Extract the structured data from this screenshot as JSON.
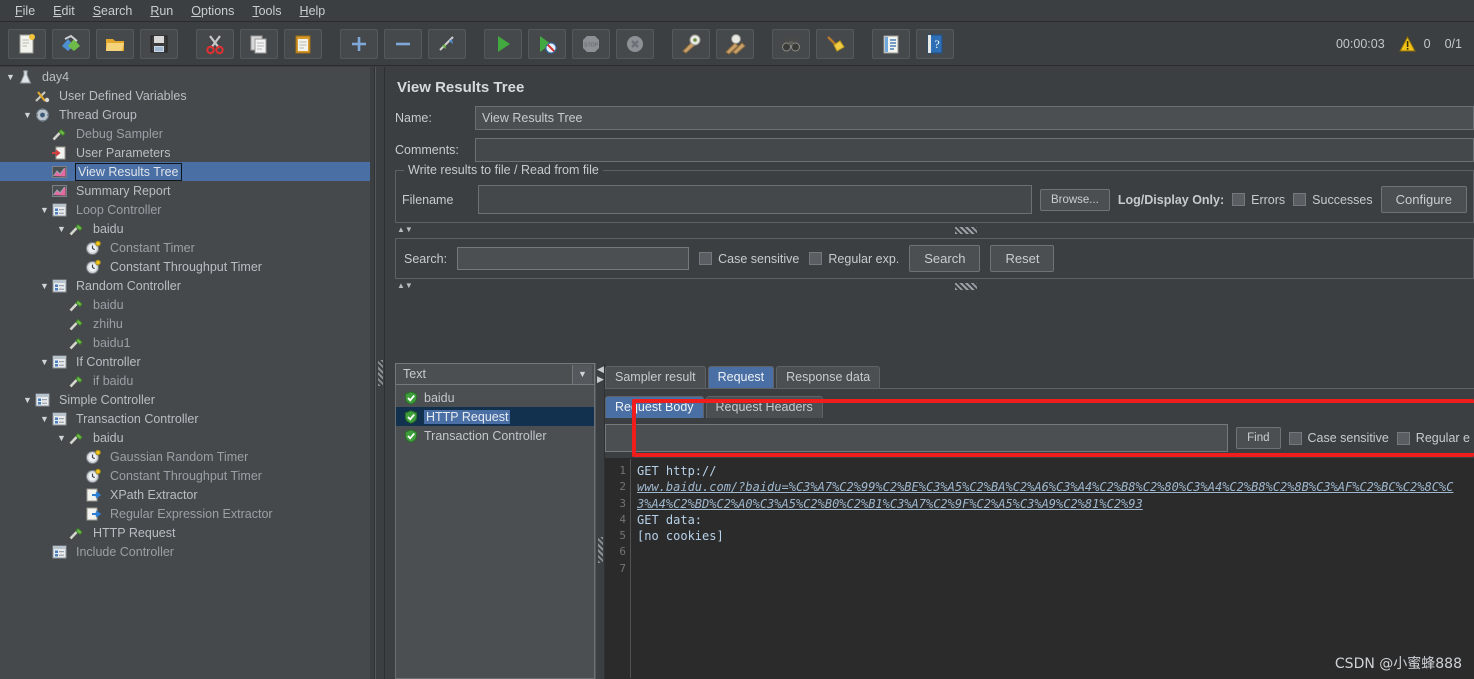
{
  "window": {
    "title": "Apache JMeter"
  },
  "menubar": {
    "items": [
      {
        "label": "File",
        "mnemonic": "F"
      },
      {
        "label": "Edit",
        "mnemonic": "E"
      },
      {
        "label": "Search",
        "mnemonic": "S"
      },
      {
        "label": "Run",
        "mnemonic": "R"
      },
      {
        "label": "Options",
        "mnemonic": "O"
      },
      {
        "label": "Tools",
        "mnemonic": "T"
      },
      {
        "label": "Help",
        "mnemonic": "H"
      }
    ]
  },
  "toolbar": {
    "buttons": [
      {
        "icon": "new-document-icon",
        "group": 1
      },
      {
        "icon": "templates-icon",
        "group": 1
      },
      {
        "icon": "open-folder-icon",
        "group": 1
      },
      {
        "icon": "save-floppy-icon",
        "group": 1
      },
      {
        "icon": "cut-scissors-icon",
        "group": 2
      },
      {
        "icon": "copy-icon",
        "group": 2
      },
      {
        "icon": "paste-clipboard-icon",
        "group": 2
      },
      {
        "icon": "expand-plus-icon",
        "group": 3
      },
      {
        "icon": "collapse-minus-icon",
        "group": 3
      },
      {
        "icon": "toggle-element-icon",
        "group": 3
      },
      {
        "icon": "start-play-icon",
        "group": 4
      },
      {
        "icon": "start-no-timers-icon",
        "group": 4
      },
      {
        "icon": "stop-icon",
        "group": 4
      },
      {
        "icon": "shutdown-icon",
        "group": 4
      },
      {
        "icon": "clear-icon",
        "group": 5
      },
      {
        "icon": "clear-all-icon",
        "group": 5
      },
      {
        "icon": "search-binoculars-icon",
        "group": 6
      },
      {
        "icon": "reset-search-broom-icon",
        "group": 6
      },
      {
        "icon": "function-helper-icon",
        "group": 7
      },
      {
        "icon": "help-question-icon",
        "group": 7
      }
    ],
    "elapsed_time": "00:00:03",
    "warning_count": "0",
    "thread_count": "0/1"
  },
  "tree": {
    "nodes": [
      {
        "label": "day4",
        "icon": "test-plan-icon",
        "indent": 0,
        "twisty": "down",
        "dim": false,
        "selected": false
      },
      {
        "label": "User Defined Variables",
        "icon": "config-element-icon",
        "indent": 1,
        "twisty": "",
        "dim": false,
        "selected": false
      },
      {
        "label": "Thread Group",
        "icon": "thread-group-icon",
        "indent": 1,
        "twisty": "down",
        "dim": false,
        "selected": false
      },
      {
        "label": "Debug Sampler",
        "icon": "sampler-icon",
        "indent": 2,
        "twisty": "",
        "dim": true,
        "selected": false
      },
      {
        "label": "User Parameters",
        "icon": "pre-processor-icon",
        "indent": 2,
        "twisty": "",
        "dim": false,
        "selected": false
      },
      {
        "label": "View Results Tree",
        "icon": "listener-icon",
        "indent": 2,
        "twisty": "",
        "dim": false,
        "selected": true
      },
      {
        "label": "Summary Report",
        "icon": "listener-icon",
        "indent": 2,
        "twisty": "",
        "dim": false,
        "selected": false
      },
      {
        "label": "Loop Controller",
        "icon": "controller-icon",
        "indent": 2,
        "twisty": "down",
        "dim": true,
        "selected": false
      },
      {
        "label": "baidu",
        "icon": "sampler-icon",
        "indent": 3,
        "twisty": "down",
        "dim": false,
        "selected": false
      },
      {
        "label": "Constant Timer",
        "icon": "timer-icon",
        "indent": 4,
        "twisty": "",
        "dim": true,
        "selected": false
      },
      {
        "label": "Constant Throughput Timer",
        "icon": "timer-icon",
        "indent": 4,
        "twisty": "",
        "dim": false,
        "selected": false
      },
      {
        "label": "Random Controller",
        "icon": "controller-icon",
        "indent": 2,
        "twisty": "down",
        "dim": false,
        "selected": false
      },
      {
        "label": "baidu",
        "icon": "sampler-icon",
        "indent": 3,
        "twisty": "",
        "dim": true,
        "selected": false
      },
      {
        "label": "zhihu",
        "icon": "sampler-icon",
        "indent": 3,
        "twisty": "",
        "dim": true,
        "selected": false
      },
      {
        "label": "baidu1",
        "icon": "sampler-icon",
        "indent": 3,
        "twisty": "",
        "dim": true,
        "selected": false
      },
      {
        "label": "If Controller",
        "icon": "controller-icon",
        "indent": 2,
        "twisty": "down",
        "dim": false,
        "selected": false
      },
      {
        "label": "if baidu",
        "icon": "sampler-icon",
        "indent": 3,
        "twisty": "",
        "dim": true,
        "selected": false
      },
      {
        "label": "Simple Controller",
        "icon": "controller-icon",
        "indent": 1,
        "twisty": "down",
        "dim": false,
        "selected": false
      },
      {
        "label": "Transaction Controller",
        "icon": "controller-icon",
        "indent": 2,
        "twisty": "down",
        "dim": false,
        "selected": false
      },
      {
        "label": "baidu",
        "icon": "sampler-icon",
        "indent": 3,
        "twisty": "down",
        "dim": false,
        "selected": false
      },
      {
        "label": "Gaussian Random Timer",
        "icon": "timer-icon",
        "indent": 4,
        "twisty": "",
        "dim": true,
        "selected": false
      },
      {
        "label": "Constant Throughput Timer",
        "icon": "timer-icon",
        "indent": 4,
        "twisty": "",
        "dim": true,
        "selected": false
      },
      {
        "label": "XPath Extractor",
        "icon": "post-processor-icon",
        "indent": 4,
        "twisty": "",
        "dim": false,
        "selected": false
      },
      {
        "label": "Regular Expression Extractor",
        "icon": "post-processor-icon",
        "indent": 4,
        "twisty": "",
        "dim": true,
        "selected": false
      },
      {
        "label": "HTTP Request",
        "icon": "sampler-icon",
        "indent": 3,
        "twisty": "",
        "dim": false,
        "selected": false
      },
      {
        "label": "Include Controller",
        "icon": "controller-icon",
        "indent": 2,
        "twisty": "",
        "dim": true,
        "selected": false
      }
    ]
  },
  "panel": {
    "title": "View Results Tree",
    "name_label": "Name:",
    "name_value": "View Results Tree",
    "comments_label": "Comments:",
    "comments_value": "",
    "file_group": {
      "legend": "Write results to file / Read from file",
      "filename_label": "Filename",
      "filename_value": "",
      "browse_label": "Browse...",
      "log_display_label": "Log/Display Only:",
      "errors_label": "Errors",
      "successes_label": "Successes",
      "configure_label": "Configure"
    },
    "search_bar": {
      "label": "Search:",
      "value": "",
      "case_sensitive_label": "Case sensitive",
      "regular_exp_label": "Regular exp.",
      "search_button": "Search",
      "reset_button": "Reset"
    }
  },
  "results": {
    "renderer_selected": "Text",
    "items": [
      {
        "label": "baidu",
        "status": "success",
        "selected": false
      },
      {
        "label": "HTTP Request",
        "status": "success",
        "selected": true
      },
      {
        "label": "Transaction Controller",
        "status": "success",
        "selected": false
      }
    ],
    "main_tabs": [
      {
        "label": "Sampler result",
        "active": false
      },
      {
        "label": "Request",
        "active": true
      },
      {
        "label": "Response data",
        "active": false
      }
    ],
    "sub_tabs": [
      {
        "label": "Request Body",
        "active": true
      },
      {
        "label": "Request Headers",
        "active": false
      }
    ],
    "find_bar": {
      "value": "",
      "find_button": "Find",
      "case_sensitive_label": "Case sensitive",
      "regular_exp_label": "Regular e"
    },
    "editor": {
      "line_numbers": [
        "1",
        "2",
        "3",
        "4",
        "5",
        "6",
        "7"
      ],
      "lines": [
        {
          "text": "GET http://",
          "style": "plain"
        },
        {
          "text": "www.baidu.com/?baidu=%C3%A7%C2%99%C2%BE%C3%A5%C2%BA%C2%A6%C3%A4%C2%B8%C2%80%C3%A4%C2%B8%C2%8B%C3%AF%C2%BC%C2%8C%C3%A4%C2%BD%C2%A0%C3%A5%C2%B0%C2%B1%C3%A7%C2%9F%C2%A5%C3%A9%C2%81%C2%93",
          "style": "url"
        },
        {
          "text": "",
          "style": "plain"
        },
        {
          "text": "GET data:",
          "style": "plain"
        },
        {
          "text": "",
          "style": "plain"
        },
        {
          "text": "",
          "style": "plain"
        },
        {
          "text": "[no cookies]",
          "style": "plain"
        },
        {
          "text": "",
          "style": "plain"
        }
      ]
    }
  },
  "annotation": {
    "highlight_color": "#f01d1d"
  },
  "watermark": {
    "text": "CSDN @小蜜蜂888"
  }
}
